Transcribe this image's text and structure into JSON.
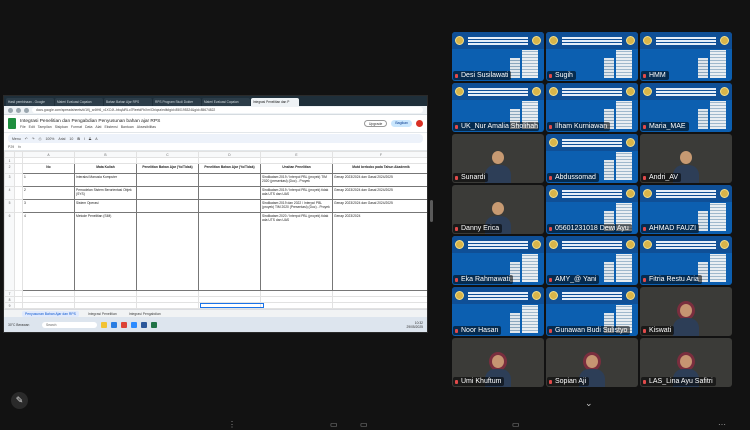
{
  "browser": {
    "tabs": [
      "Hasil pembinaan - Google",
      "Materi Evaluasi Capaian",
      "Bahan Bahan Ajar RPS",
      "RPS Program Studi Dokter",
      "Materi Evaluasi Capaian",
      "Integrasi Penelitian dan P"
    ],
    "active_tab": 5,
    "url": "docs.google.com/spreadsheets/d/1Kj_w4tH6_x1XC4f--bbqAiRLo7ReetdFbXm/Cbiqxa/edit#gid=850195324&gid=85674822"
  },
  "sheet": {
    "title": "Integrasi Penelitian dan Pengabdian Penyusunan bahan ajar RPS",
    "menus": [
      "File",
      "Edit",
      "Tampilan",
      "Sisipkan",
      "Format",
      "Data",
      "Alat",
      "Ekstensi",
      "Bantuan",
      "Aksesibilitas"
    ],
    "share_label": "Bagikan",
    "upgrade_label": "Upgrade",
    "menu_label": "Menu",
    "zoom": "100%",
    "font": "Arial",
    "font_size": "10",
    "name_box": "P29",
    "columns": [
      "A",
      "B",
      "C",
      "D",
      "E",
      "F",
      "G"
    ],
    "headers": [
      "No",
      "Mata Kuliah",
      "Penelitian Bahan Ajar (Yo/Tidak)",
      "Penelitian Bahan Ajar (Yo/Tidak)",
      "Unsitan Penelitian",
      "Mutd berbobo pada Tahun Akademik",
      "Alasan Perubahan"
    ],
    "rows": [
      [
        "1",
        "Interaksi Manusia Komputer",
        "",
        "",
        "Sindikatam 2019 / Interpol PBL (proyek) TIM 2020 (presentasi) (Doc) - Proyek",
        "Genap 2023/2024 dan Gasal 2024/2025",
        ""
      ],
      [
        "2",
        "Pemodelan Sistem Berorientasi Objek (SYS)",
        "",
        "",
        "Sindikatam 2019 / Interpol PBL (proyek) tidak ada UTS dan UAS",
        "Genap 2023/2024 dan Gasal 2024/2025",
        ""
      ],
      [
        "3",
        "Sistem Operasi",
        "",
        "",
        "Sindikatam 2019 dan 2022 / Interpol PBL (proyek) TIM 2020 (Presentasi) (Doc) - Proyek",
        "Genap 2023/2024 dan Gasal 2024/2025",
        ""
      ],
      [
        "4",
        "Metode Penelitian (SIM)",
        "",
        "",
        "Sindikatam 2020 / Interpol PBL (proyek) tidak ada UTS dan UAS",
        "Genap 2023/2024",
        "pengaruh KOHORITH III sudah tidak menggunakan mata kuliah ini, karena harus sudah berubah menjadi Metodologi Penelitian (Smt 6 T)"
      ]
    ],
    "sheet_tabs": [
      "Penyusunan Bahan Ajar dan RPS",
      "Integrasi Penelitian",
      "Integrasi Pengabdian"
    ],
    "active_sheet_tab": 0
  },
  "taskbar": {
    "weather": "30°C Berawan",
    "search_placeholder": "Search",
    "time": "10:32",
    "date": "29/05/2025"
  },
  "participants": [
    {
      "name": "Desi Susilawati",
      "video": false
    },
    {
      "name": "Sugih",
      "video": false
    },
    {
      "name": "HMM",
      "video": false
    },
    {
      "name": "UK_Nur Amalia Sholihah",
      "video": false
    },
    {
      "name": "Ilham Kurniawan",
      "video": false
    },
    {
      "name": "Maria_MAE",
      "video": false
    },
    {
      "name": "Sunardi",
      "video": true
    },
    {
      "name": "Abdussomad",
      "video": false
    },
    {
      "name": "Andri_AV",
      "video": true
    },
    {
      "name": "Danny Erica",
      "video": true
    },
    {
      "name": "05601231018 Dewi Ayu",
      "video": false
    },
    {
      "name": "AHMAD FAUZI",
      "video": false
    },
    {
      "name": "Eka Rahmawati",
      "video": false
    },
    {
      "name": "AMY_@ Yani",
      "video": false
    },
    {
      "name": "Fitria Restu Aria",
      "video": false
    },
    {
      "name": "Noor Hasan",
      "video": false
    },
    {
      "name": "Gunawan Budi Sulistyo",
      "video": false
    },
    {
      "name": "Kiswati",
      "video": true
    },
    {
      "name": "Umi Khuftum",
      "video": true
    },
    {
      "name": "Sopian Aji",
      "video": true
    },
    {
      "name": "LAS_Lina Ayu Safitri",
      "video": true
    }
  ],
  "icons": {
    "draw": "pencil-icon",
    "expand": "chevron-down-icon"
  }
}
